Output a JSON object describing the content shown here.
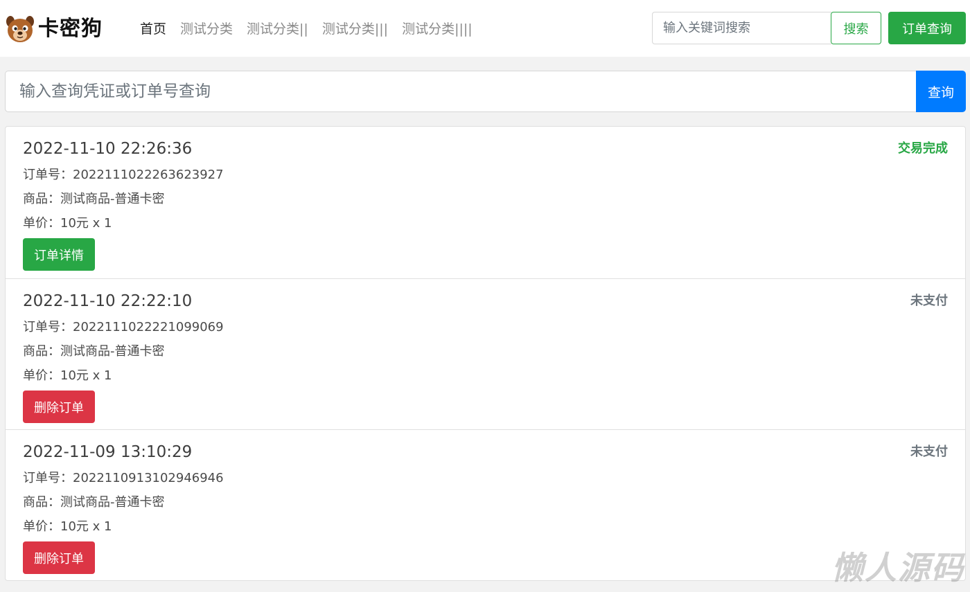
{
  "brand": {
    "name": "卡密狗",
    "logo_icon": "dog-face-icon"
  },
  "nav": {
    "items": [
      {
        "label": "首页",
        "active": true
      },
      {
        "label": "测试分类",
        "active": false
      },
      {
        "label": "测试分类||",
        "active": false
      },
      {
        "label": "测试分类|||",
        "active": false
      },
      {
        "label": "测试分类||||",
        "active": false
      }
    ]
  },
  "header": {
    "search_placeholder": "输入关键词搜索",
    "search_label": "搜索",
    "order_query_label": "订单查询"
  },
  "query": {
    "placeholder": "输入查询凭证或订单号查询",
    "button_label": "查询"
  },
  "orders": [
    {
      "time": "2022-11-10 22:26:36",
      "order_no": "订单号：2022111022263623927",
      "product": "商品：测试商品-普通卡密",
      "price": "单价：10元 x 1",
      "status": "交易完成",
      "action": "订单详情"
    },
    {
      "time": "2022-11-10 22:22:10",
      "order_no": "订单号：2022111022221099069",
      "product": "商品：测试商品-普通卡密",
      "price": "单价：10元 x 1",
      "status": "未支付",
      "action": "删除订单"
    },
    {
      "time": "2022-11-09 13:10:29",
      "order_no": "订单号：2022110913102946946",
      "product": "商品：测试商品-普通卡密",
      "price": "单价：10元 x 1",
      "status": "未支付",
      "action": "删除订单"
    }
  ],
  "colors": {
    "success": "#28a745",
    "danger": "#dc3545",
    "primary": "#007bff",
    "muted": "#6c757d"
  },
  "watermark": "懒人源码"
}
